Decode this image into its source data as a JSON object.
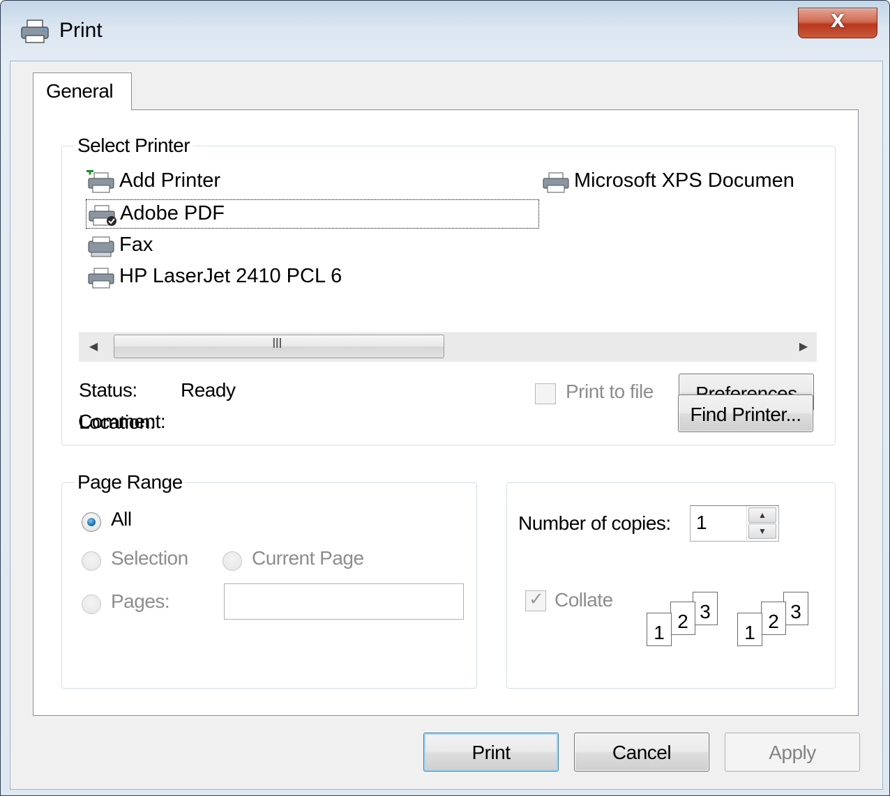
{
  "window": {
    "title": "Print",
    "close_glyph": "X",
    "title_icon": "printer-icon"
  },
  "tabs": [
    {
      "label": "General",
      "selected": true
    }
  ],
  "select_printer": {
    "group_title": "Select Printer",
    "printers": [
      {
        "label": "Add Printer",
        "icon": "add-printer-icon"
      },
      {
        "label": "Adobe PDF",
        "icon": "default-printer-icon",
        "selected": true
      },
      {
        "label": "Fax",
        "icon": "fax-icon"
      },
      {
        "label": "HP LaserJet 2410 PCL 6",
        "icon": "printer-icon"
      },
      {
        "label": "Microsoft XPS Documen",
        "icon": "printer-icon"
      }
    ],
    "scrollbar": {
      "left_arrow": "◀",
      "right_arrow": "▶",
      "grip": "III"
    },
    "status_label": "Status:",
    "status_value": "Ready",
    "location_label": "Location:",
    "comment_label": "Comment:",
    "print_to_file_label": "Print to file",
    "print_to_file_checked": false,
    "preferences_label": "Preferences",
    "find_printer_label": "Find Printer..."
  },
  "page_range": {
    "group_title": "Page Range",
    "all_label": "All",
    "selection_label": "Selection",
    "current_page_label": "Current Page",
    "pages_label": "Pages:",
    "pages_value": "",
    "selected_option": "All"
  },
  "copies": {
    "number_label": "Number of copies:",
    "number_value": "1",
    "spin_up": "▲",
    "spin_down": "▼",
    "collate_label": "Collate",
    "collate_checked": true,
    "check_glyph": "✓",
    "collate_pages": [
      "1",
      "2",
      "3"
    ]
  },
  "buttons": {
    "print": "Print",
    "cancel": "Cancel",
    "apply": "Apply"
  }
}
